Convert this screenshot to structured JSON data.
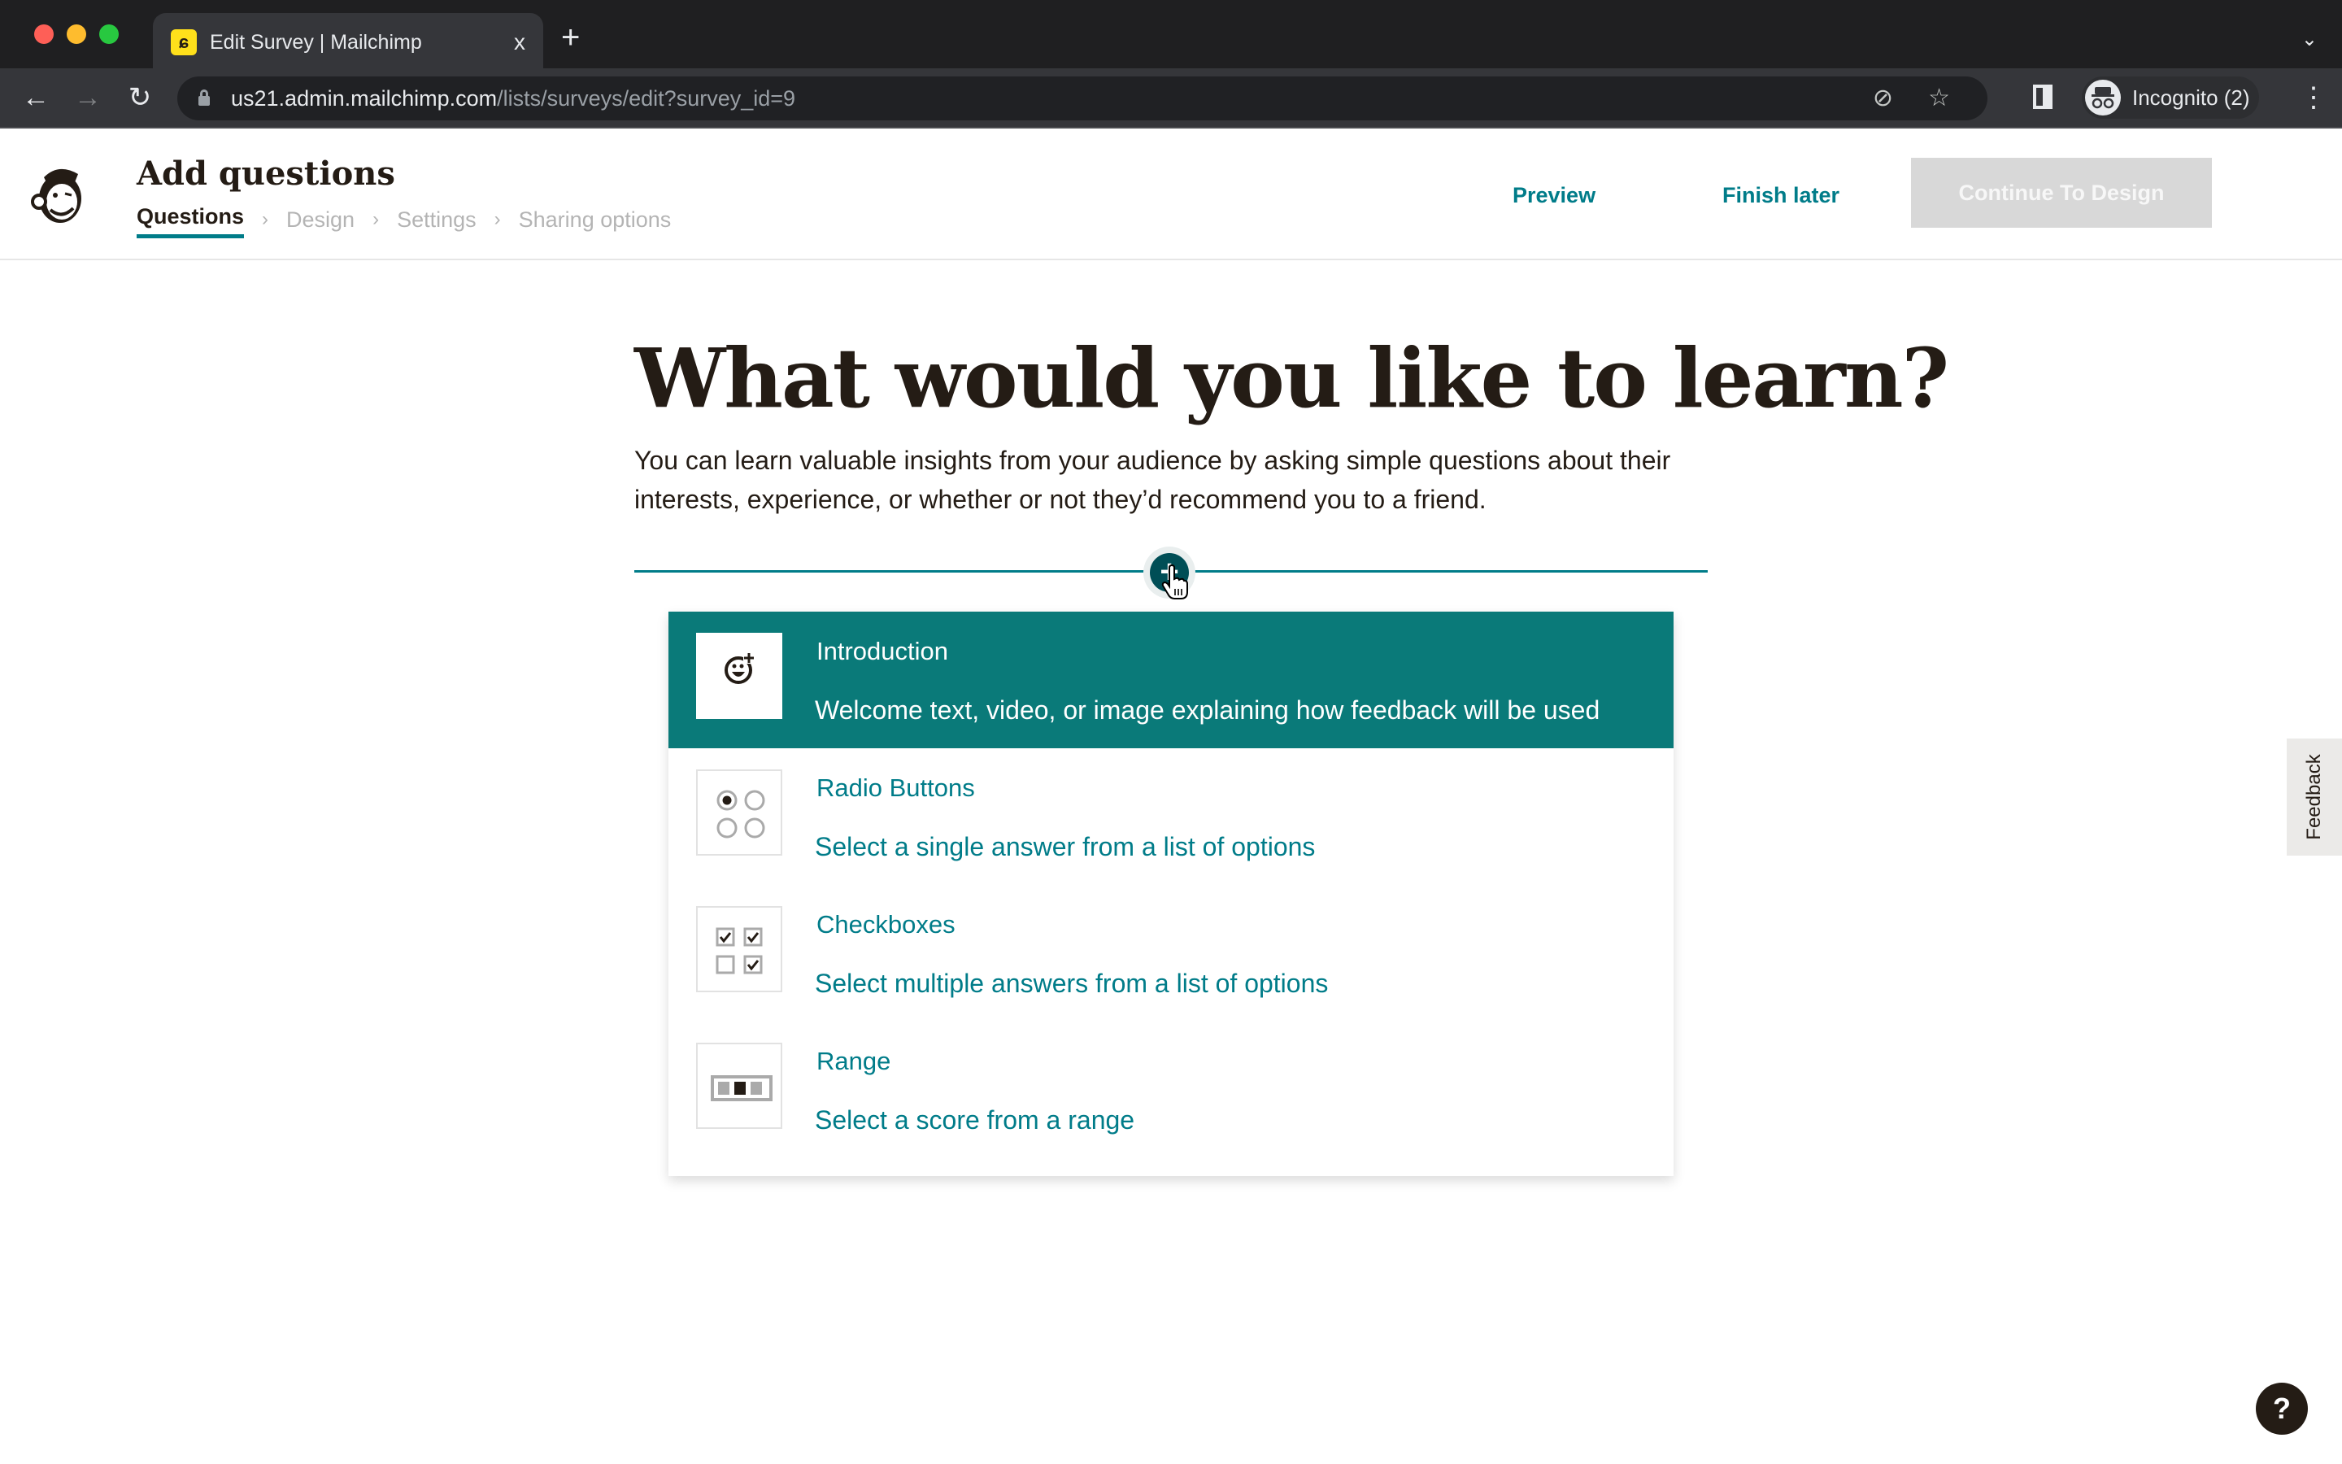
{
  "browser": {
    "tab_title": "Edit Survey | Mailchimp",
    "tab_close": "x",
    "new_tab": "+",
    "tabs_menu": "⌄",
    "url_host": "us21.admin.mailchimp.com",
    "url_path": "/lists/surveys/edit?survey_id=9",
    "profile_label": "Incognito (2)",
    "icons": {
      "back": "←",
      "forward": "→",
      "reload": "↻",
      "eye_off": "⊘",
      "star": "☆",
      "menu": "⋮",
      "incognito": "🕶"
    }
  },
  "header": {
    "title": "Add questions",
    "steps": [
      {
        "label": "Questions",
        "active": true
      },
      {
        "label": "Design",
        "active": false
      },
      {
        "label": "Settings",
        "active": false
      },
      {
        "label": "Sharing options",
        "active": false
      }
    ],
    "chevron": "›",
    "preview_label": "Preview",
    "finish_later_label": "Finish later",
    "continue_label": "Continue To Design"
  },
  "main": {
    "headline": "What would you like to learn?",
    "intro": "You can learn valuable insights from your audience by asking simple questions about their interests, experience, or whether or not they’d recommend you to a friend.",
    "add_button": "+",
    "question_types": [
      {
        "label": "Introduction",
        "description": "Welcome text, video, or image explaining how feedback will be used",
        "icon": "smiley-plus-icon",
        "selected": true
      },
      {
        "label": "Radio Buttons",
        "description": "Select a single answer from a list of options",
        "icon": "radio-buttons-icon",
        "selected": false
      },
      {
        "label": "Checkboxes",
        "description": "Select multiple answers from a list of options",
        "icon": "checkboxes-icon",
        "selected": false
      },
      {
        "label": "Range",
        "description": "Select a score from a range",
        "icon": "range-icon",
        "selected": false
      }
    ]
  },
  "feedback_tab": "Feedback",
  "help_button": "?",
  "colors": {
    "brand_teal": "#007c89",
    "selected_row": "#0a7a79",
    "disabled_button": "#d8d8d8",
    "text_dark": "#241c15"
  }
}
